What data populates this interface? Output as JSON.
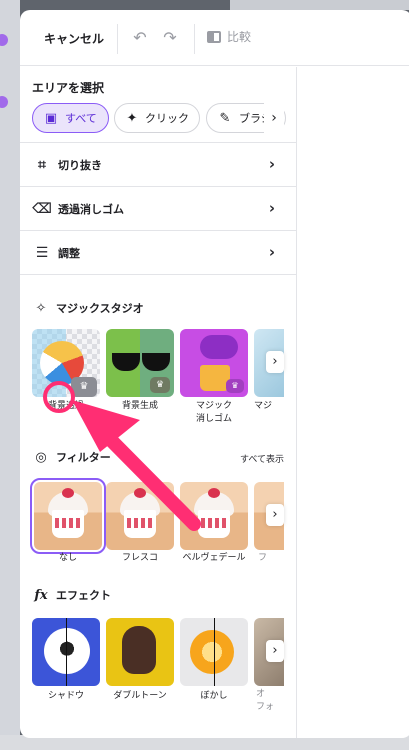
{
  "toolbar": {
    "cancel_label": "キャンセル",
    "undo_icon": "undo-icon",
    "redo_icon": "redo-icon",
    "compare_label": "比較"
  },
  "area_select": {
    "heading": "エリアを選択",
    "chips": [
      {
        "label": "すべて",
        "icon": "image-icon",
        "active": true
      },
      {
        "label": "クリック",
        "icon": "cursor-sparkle-icon",
        "active": false
      },
      {
        "label": "ブラシ",
        "icon": "magic-brush-icon",
        "active": false
      }
    ]
  },
  "tools": [
    {
      "label": "切り抜き",
      "icon": "crop-icon"
    },
    {
      "label": "透過消しゴム",
      "icon": "eraser-icon"
    },
    {
      "label": "調整",
      "icon": "sliders-icon"
    }
  ],
  "magic_studio": {
    "heading": "マジックスタジオ",
    "items": [
      {
        "label": "背景透過"
      },
      {
        "label": "背景生成"
      },
      {
        "label_line1": "マジック",
        "label_line2": "消しゴム"
      },
      {
        "label": "マジ"
      }
    ]
  },
  "filters": {
    "heading": "フィルター",
    "show_all": "すべて表示",
    "items": [
      {
        "label": "なし",
        "selected": true
      },
      {
        "label": "フレスコ"
      },
      {
        "label": "ベルヴェデール"
      },
      {
        "label": "フ"
      }
    ]
  },
  "effects": {
    "heading": "エフェクト",
    "items": [
      {
        "label": "シャドウ"
      },
      {
        "label": "ダブルトーン"
      },
      {
        "label": "ぼかし"
      },
      {
        "label_line1": "オ",
        "label_line2": "フォ"
      }
    ]
  },
  "colors": {
    "accent": "#8b5cf6",
    "annotation": "#ff2e73"
  }
}
